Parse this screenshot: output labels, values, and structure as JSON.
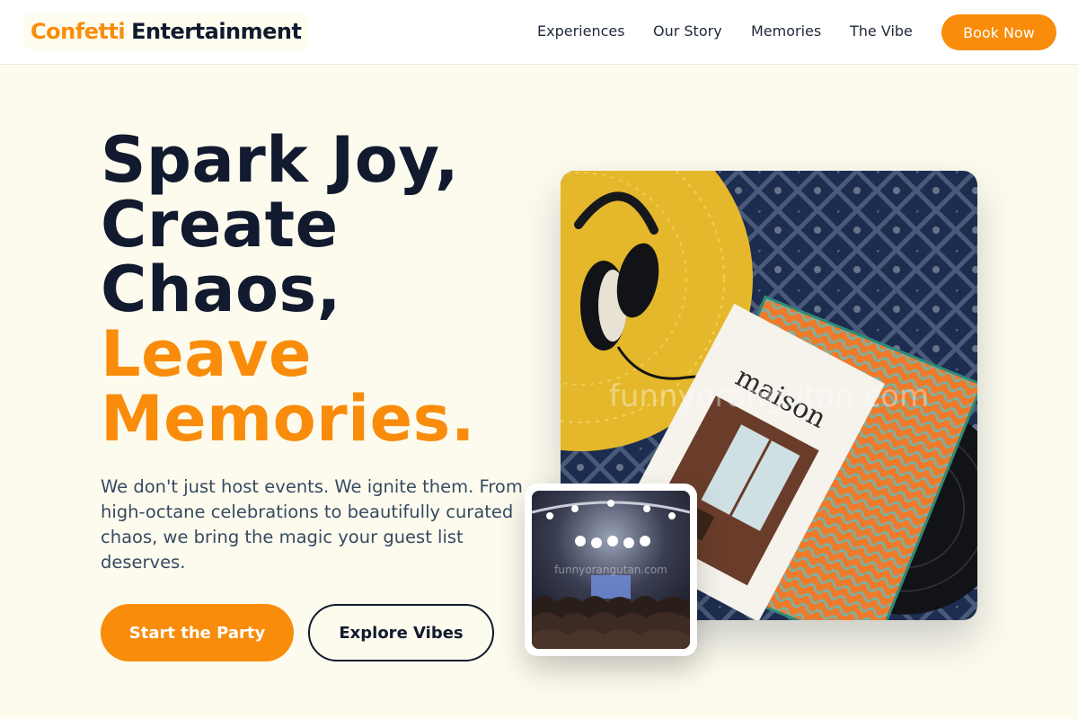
{
  "brand": {
    "name_first": "Confetti",
    "name_second": "Entertainment"
  },
  "nav": {
    "links": [
      "Experiences",
      "Our Story",
      "Memories",
      "The Vibe"
    ],
    "cta": "Book Now"
  },
  "hero": {
    "headline_lines": [
      "Spark Joy,",
      "Create",
      "Chaos,"
    ],
    "highlight_lines": [
      "Leave",
      "Memories."
    ],
    "subtitle": "We don't just host events. We ignite them. From high-octane celebrations to beautifully curated chaos, we bring the magic your guest list deserves.",
    "primary_button": "Start the Party",
    "secondary_button": "Explore Vibes"
  },
  "images": {
    "main_photo_text": "maison",
    "watermark": "funnyorangutan.com",
    "small_watermark": "funnyorangutan.com"
  },
  "colors": {
    "accent": "#f98c0a",
    "dark": "#111a2e",
    "background": "#fdfbee",
    "body_text": "#374a62"
  }
}
